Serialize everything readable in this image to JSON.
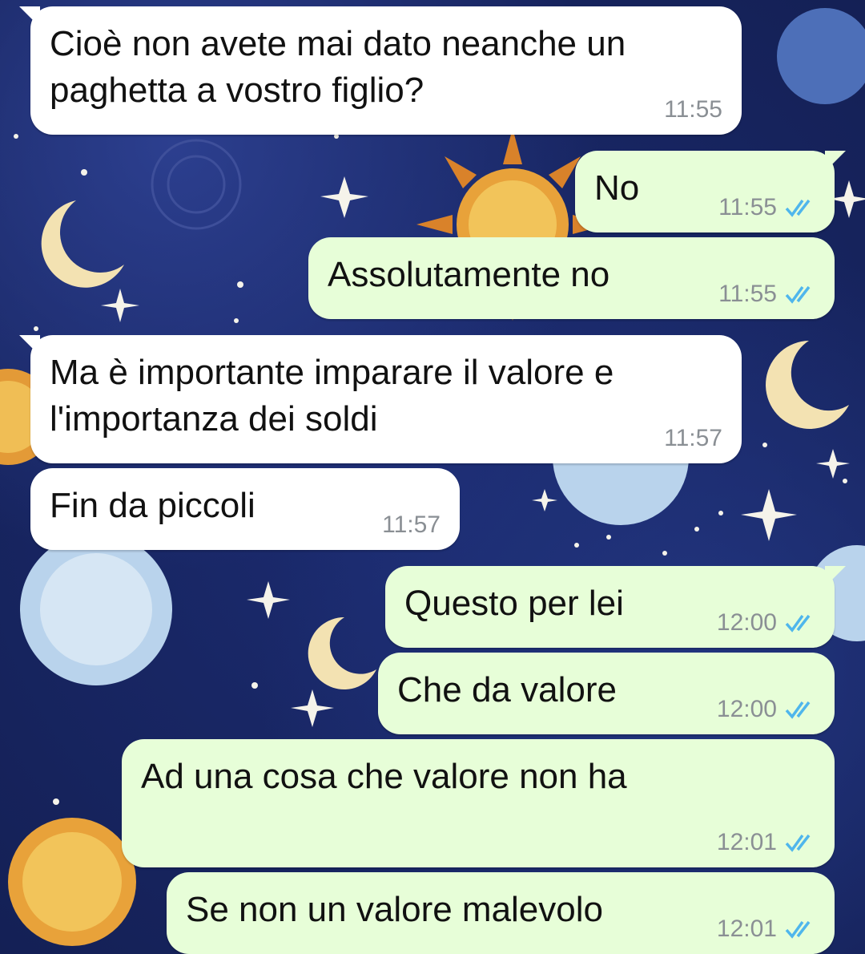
{
  "colors": {
    "incoming_bubble": "#ffffff",
    "outgoing_bubble": "#e7fed8",
    "timestamp": "#8a8f94",
    "read_ticks": "#4fb6ec",
    "wallpaper": "#1b2a6b"
  },
  "messages": [
    {
      "direction": "incoming",
      "text": "Cioè non avete mai dato neanche un\npaghetta a vostro figlio?",
      "time": "11:55"
    },
    {
      "direction": "outgoing",
      "text": "No",
      "time": "11:55",
      "status_icon": "double-check-read-icon"
    },
    {
      "direction": "outgoing",
      "text": "Assolutamente no",
      "time": "11:55",
      "status_icon": "double-check-read-icon"
    },
    {
      "direction": "incoming",
      "text": "Ma è importante imparare il valore e\nl'importanza dei soldi",
      "time": "11:57"
    },
    {
      "direction": "incoming",
      "text": "Fin da piccoli",
      "time": "11:57"
    },
    {
      "direction": "outgoing",
      "text": "Questo per lei",
      "time": "12:00",
      "status_icon": "double-check-read-icon"
    },
    {
      "direction": "outgoing",
      "text": "Che da valore",
      "time": "12:00",
      "status_icon": "double-check-read-icon"
    },
    {
      "direction": "outgoing",
      "text": "Ad una cosa che valore non ha",
      "time": "12:01",
      "status_icon": "double-check-read-icon"
    },
    {
      "direction": "outgoing",
      "text": "Se non un valore malevolo",
      "time": "12:01",
      "status_icon": "double-check-read-icon"
    }
  ]
}
